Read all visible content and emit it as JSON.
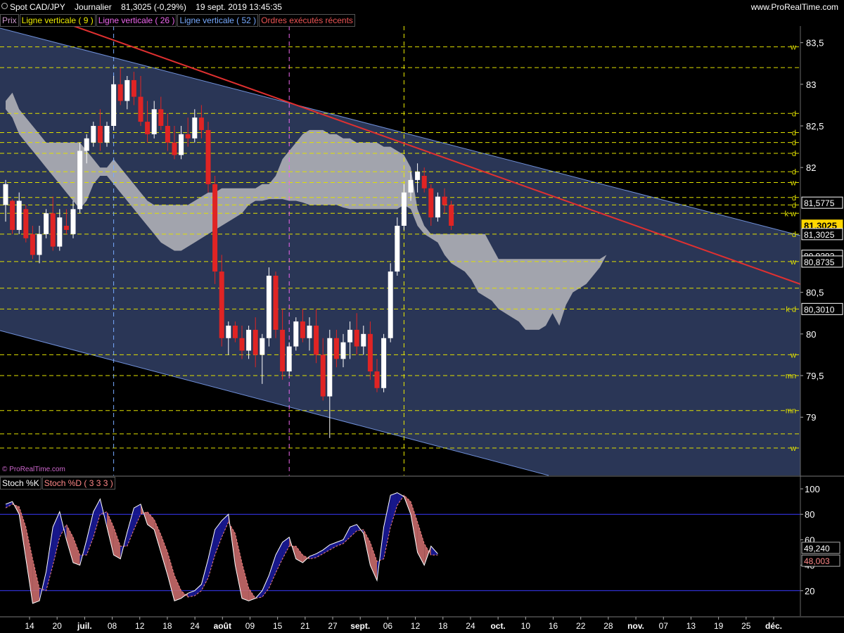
{
  "header": {
    "symbol": "Spot CAD/JPY",
    "period": "Journalier",
    "last": "81,3025 (-0,29%)",
    "datetime": "19 sept. 2019 13:45:35",
    "site": "www.ProRealTime.com"
  },
  "legend": [
    {
      "label": "Prix",
      "color": "#c9c"
    },
    {
      "label": "Ligne verticale ( 9 )",
      "color": "#ee0"
    },
    {
      "label": "Ligne verticale ( 26 )",
      "color": "#e6e"
    },
    {
      "label": "Ligne verticale ( 52 )",
      "color": "#7af"
    },
    {
      "label": "Ordres exécutés récents",
      "color": "#e55"
    }
  ],
  "stoch_legend": [
    {
      "label": "Stoch %K",
      "color": "#fff"
    },
    {
      "label": "Stoch %D ( 3 3 3 )",
      "color": "#f88"
    }
  ],
  "watermark": "© ProRealTime.com",
  "colors": {
    "background": "#000000",
    "channel_fill": "#2a3656",
    "cloud": "#b7b7bc",
    "up_candle": "#ffffff",
    "down_candle": "#e02424",
    "level_line": "#e0e000",
    "trend_line": "#e03030",
    "channel_line": "#6f8fd8"
  },
  "chart_data": [
    {
      "type": "candlestick",
      "name": "Prix",
      "ylim": [
        78.3,
        83.7
      ],
      "y_ticks": [
        "83,5",
        "83",
        "82,5",
        "82",
        "80,5",
        "80",
        "79,5",
        "79"
      ],
      "x_tick_labels": [
        "14",
        "20",
        "juil.",
        "08",
        "12",
        "18",
        "24",
        "août",
        "09",
        "15",
        "21",
        "27",
        "sept.",
        "06",
        "12",
        "18",
        "24",
        "oct.",
        "10",
        "16",
        "22",
        "28",
        "nov.",
        "07",
        "13",
        "19",
        "25",
        "déc."
      ],
      "price_labels": [
        {
          "text": "81,5775",
          "value": 81.5775,
          "style": "plain"
        },
        {
          "text": "81,3025",
          "value": 81.3025,
          "style": "current"
        },
        {
          "text": "81,3025",
          "value": 81.2,
          "style": "plain"
        },
        {
          "text": "80,9393",
          "value": 80.94,
          "style": "plain"
        },
        {
          "text": "80,8735",
          "value": 80.87,
          "style": "plain"
        },
        {
          "text": "80,3010",
          "value": 80.3,
          "style": "plain"
        }
      ],
      "level_lines": [
        {
          "value": 83.45,
          "tag": "w"
        },
        {
          "value": 83.2,
          "tag": ""
        },
        {
          "value": 82.65,
          "tag": "d"
        },
        {
          "value": 82.42,
          "tag": "d"
        },
        {
          "value": 82.3,
          "tag": "d"
        },
        {
          "value": 82.17,
          "tag": "d"
        },
        {
          "value": 81.95,
          "tag": "d"
        },
        {
          "value": 81.82,
          "tag": "w"
        },
        {
          "value": 81.64,
          "tag": "d"
        },
        {
          "value": 81.55,
          "tag": "d"
        },
        {
          "value": 81.45,
          "tag": "k w"
        },
        {
          "value": 81.2,
          "tag": "d"
        },
        {
          "value": 80.87,
          "tag": "w"
        },
        {
          "value": 80.55,
          "tag": ""
        },
        {
          "value": 80.3,
          "tag": "k d"
        },
        {
          "value": 79.75,
          "tag": "w"
        },
        {
          "value": 79.5,
          "tag": "mn"
        },
        {
          "value": 79.08,
          "tag": "mn"
        },
        {
          "value": 78.8,
          "tag": ""
        },
        {
          "value": 78.63,
          "tag": "w"
        }
      ],
      "vertical_markers": [
        {
          "name": "Ligne verticale ( 52 )",
          "index": 16,
          "color": "#7af"
        },
        {
          "name": "Ligne verticale ( 26 )",
          "index": 42,
          "color": "#e6e"
        },
        {
          "name": "Ligne verticale ( 9 )",
          "index": 59,
          "color": "#ee0"
        }
      ],
      "candles": [
        [
          81.55,
          81.85,
          81.35,
          81.8
        ],
        [
          81.6,
          81.62,
          81.2,
          81.25
        ],
        [
          81.25,
          81.7,
          81.2,
          81.6
        ],
        [
          81.5,
          81.55,
          81.1,
          81.15
        ],
        [
          81.2,
          81.3,
          80.9,
          80.95
        ],
        [
          80.95,
          81.3,
          80.85,
          81.2
        ],
        [
          81.2,
          81.5,
          81.15,
          81.45
        ],
        [
          81.45,
          81.65,
          81.0,
          81.05
        ],
        [
          81.05,
          81.5,
          81.0,
          81.4
        ],
        [
          81.3,
          81.5,
          81.2,
          81.25
        ],
        [
          81.2,
          81.6,
          81.15,
          81.5
        ],
        [
          81.5,
          82.3,
          81.45,
          82.2
        ],
        [
          82.2,
          82.4,
          82.05,
          82.35
        ],
        [
          82.3,
          82.55,
          82.25,
          82.5
        ],
        [
          82.5,
          82.7,
          82.2,
          82.3
        ],
        [
          82.3,
          82.55,
          82.25,
          82.5
        ],
        [
          82.5,
          83.1,
          82.45,
          83.0
        ],
        [
          83.0,
          83.2,
          82.75,
          82.8
        ],
        [
          82.8,
          83.1,
          82.7,
          83.05
        ],
        [
          83.05,
          83.15,
          82.75,
          82.85
        ],
        [
          82.85,
          83.1,
          82.5,
          82.55
        ],
        [
          82.55,
          82.8,
          82.3,
          82.4
        ],
        [
          82.4,
          82.8,
          82.35,
          82.7
        ],
        [
          82.7,
          82.85,
          82.45,
          82.5
        ],
        [
          82.5,
          82.65,
          82.2,
          82.3
        ],
        [
          82.3,
          82.5,
          82.1,
          82.15
        ],
        [
          82.15,
          82.5,
          82.1,
          82.4
        ],
        [
          82.4,
          82.6,
          82.25,
          82.35
        ],
        [
          82.35,
          82.7,
          82.3,
          82.6
        ],
        [
          82.6,
          82.75,
          82.35,
          82.45
        ],
        [
          82.45,
          82.55,
          81.7,
          81.8
        ],
        [
          81.8,
          81.9,
          80.6,
          80.75
        ],
        [
          80.75,
          80.95,
          79.85,
          79.95
        ],
        [
          79.95,
          80.15,
          79.75,
          80.1
        ],
        [
          80.1,
          80.15,
          79.9,
          79.95
        ],
        [
          79.95,
          80.1,
          79.7,
          79.8
        ],
        [
          79.8,
          80.1,
          79.7,
          80.05
        ],
        [
          80.05,
          80.2,
          79.6,
          79.75
        ],
        [
          79.75,
          80.0,
          79.4,
          79.95
        ],
        [
          79.95,
          80.8,
          79.85,
          80.7
        ],
        [
          80.7,
          80.75,
          79.95,
          80.05
        ],
        [
          80.05,
          80.3,
          79.45,
          79.55
        ],
        [
          79.55,
          79.9,
          79.5,
          79.85
        ],
        [
          79.85,
          80.2,
          79.8,
          80.15
        ],
        [
          80.15,
          80.3,
          79.9,
          79.95
        ],
        [
          79.95,
          80.2,
          79.8,
          80.1
        ],
        [
          80.1,
          80.3,
          79.65,
          79.75
        ],
        [
          79.75,
          79.95,
          79.2,
          79.25
        ],
        [
          79.25,
          80.05,
          78.75,
          79.95
        ],
        [
          79.95,
          80.05,
          79.6,
          79.7
        ],
        [
          79.7,
          80.0,
          79.6,
          79.9
        ],
        [
          79.9,
          80.15,
          79.7,
          80.05
        ],
        [
          80.05,
          80.25,
          79.75,
          79.85
        ],
        [
          79.85,
          80.1,
          79.75,
          80.0
        ],
        [
          80.0,
          80.15,
          79.45,
          79.55
        ],
        [
          79.55,
          79.7,
          79.3,
          79.35
        ],
        [
          79.35,
          80.0,
          79.3,
          79.95
        ],
        [
          79.95,
          80.85,
          79.9,
          80.75
        ],
        [
          80.75,
          81.4,
          80.7,
          81.3
        ],
        [
          81.3,
          81.8,
          81.25,
          81.7
        ],
        [
          81.7,
          81.95,
          81.6,
          81.85
        ],
        [
          81.85,
          82.05,
          81.7,
          81.95
        ],
        [
          81.9,
          82.0,
          81.7,
          81.75
        ],
        [
          81.75,
          81.8,
          81.3,
          81.4
        ],
        [
          81.4,
          81.7,
          81.35,
          81.65
        ],
        [
          81.65,
          81.75,
          81.45,
          81.55
        ],
        [
          81.55,
          81.6,
          81.25,
          81.3
        ]
      ],
      "cloud_upper": [
        82.8,
        82.9,
        82.7,
        82.6,
        82.5,
        82.4,
        82.3,
        82.3,
        82.3,
        82.3,
        82.3,
        82.3,
        82.2,
        82.1,
        82.0,
        82.0,
        82.1,
        82.0,
        81.9,
        81.8,
        81.7,
        81.6,
        81.55,
        81.55,
        81.55,
        81.55,
        81.55,
        81.55,
        81.6,
        81.65,
        81.7,
        81.7,
        81.75,
        81.75,
        81.75,
        81.75,
        81.75,
        81.75,
        81.8,
        81.8,
        81.9,
        82.1,
        82.2,
        82.3,
        82.4,
        82.45,
        82.45,
        82.45,
        82.4,
        82.4,
        82.35,
        82.35,
        82.3,
        82.3,
        82.3,
        82.3,
        82.25,
        82.25,
        82.2,
        82.15,
        82.0,
        81.5,
        81.3,
        81.2,
        81.2,
        81.2,
        81.2,
        81.2,
        81.2,
        81.2,
        81.2,
        81.2,
        81.05,
        80.9,
        80.9,
        80.9,
        80.9,
        80.9,
        80.9,
        80.9,
        80.9,
        80.9,
        80.9,
        80.9,
        80.9,
        80.9,
        80.9,
        80.9,
        80.9,
        80.95
      ],
      "cloud_lower": [
        82.7,
        82.6,
        82.4,
        82.3,
        82.2,
        82.1,
        82.0,
        81.9,
        81.8,
        81.7,
        81.6,
        81.5,
        81.6,
        81.8,
        81.9,
        81.9,
        81.8,
        81.7,
        81.6,
        81.5,
        81.4,
        81.3,
        81.2,
        81.1,
        81.05,
        81.0,
        81.0,
        81.05,
        81.1,
        81.15,
        81.2,
        81.25,
        81.3,
        81.35,
        81.4,
        81.45,
        81.55,
        81.6,
        81.6,
        81.62,
        81.62,
        81.62,
        81.6,
        81.6,
        81.58,
        81.55,
        81.55,
        81.55,
        81.55,
        81.55,
        81.52,
        81.5,
        81.5,
        81.5,
        81.5,
        81.5,
        81.5,
        81.5,
        81.5,
        81.55,
        81.5,
        81.3,
        81.2,
        81.15,
        81.1,
        80.95,
        80.85,
        80.8,
        80.75,
        80.65,
        80.5,
        80.45,
        80.4,
        80.3,
        80.25,
        80.2,
        80.15,
        80.05,
        80.05,
        80.05,
        80.1,
        80.25,
        80.1,
        80.35,
        80.5,
        80.55,
        80.6,
        80.7,
        80.8,
        80.95
      ]
    },
    {
      "type": "line",
      "name": "Stoch",
      "ylim": [
        0,
        105
      ],
      "y_ticks": [
        "100",
        "80",
        "60",
        "40",
        "20"
      ],
      "levels": [
        80,
        20
      ],
      "labels": [
        {
          "text": "49,240",
          "value": 49.24,
          "series": "k"
        },
        {
          "text": "48,003",
          "value": 48.0,
          "series": "d"
        }
      ],
      "series": [
        {
          "name": "Stoch %K",
          "color": "#ffffff",
          "values": [
            88,
            90,
            80,
            45,
            10,
            12,
            35,
            70,
            82,
            60,
            42,
            40,
            60,
            82,
            92,
            70,
            48,
            45,
            66,
            85,
            88,
            72,
            68,
            50,
            32,
            12,
            14,
            18,
            20,
            25,
            45,
            68,
            75,
            80,
            40,
            14,
            12,
            14,
            20,
            32,
            48,
            58,
            62,
            45,
            42,
            47,
            49,
            52,
            56,
            58,
            60,
            70,
            72,
            65,
            40,
            28,
            70,
            95,
            97,
            94,
            80,
            50,
            40,
            55,
            49
          ]
        },
        {
          "name": "Stoch %D ( 3 3 3 )",
          "color": "#f08080",
          "values": [
            85,
            88,
            86,
            70,
            45,
            22,
            20,
            40,
            62,
            72,
            62,
            48,
            48,
            62,
            80,
            82,
            70,
            55,
            55,
            68,
            80,
            82,
            76,
            64,
            50,
            32,
            20,
            15,
            16,
            20,
            30,
            48,
            62,
            74,
            65,
            42,
            22,
            14,
            15,
            22,
            34,
            45,
            55,
            55,
            48,
            45,
            46,
            49,
            52,
            55,
            57,
            62,
            67,
            68,
            58,
            43,
            45,
            70,
            87,
            95,
            90,
            74,
            57,
            48,
            48
          ]
        }
      ]
    }
  ]
}
